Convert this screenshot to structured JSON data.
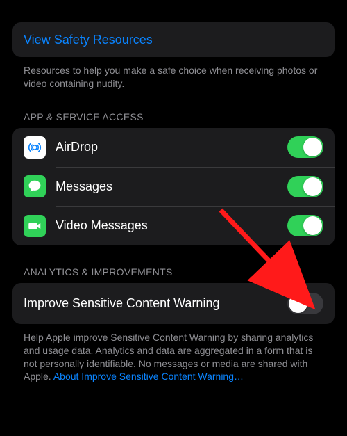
{
  "safety": {
    "link_label": "View Safety Resources",
    "footer": "Resources to help you make a safe choice when receiving photos or video containing nudity."
  },
  "app_access": {
    "header": "APP & SERVICE ACCESS",
    "items": [
      {
        "label": "AirDrop",
        "icon": "airdrop",
        "on": true
      },
      {
        "label": "Messages",
        "icon": "messages",
        "on": true
      },
      {
        "label": "Video Messages",
        "icon": "video",
        "on": true
      }
    ]
  },
  "analytics": {
    "header": "ANALYTICS & IMPROVEMENTS",
    "row_label": "Improve Sensitive Content Warning",
    "toggle_on": false,
    "footer_pre": "Help Apple improve Sensitive Content Warning by sharing analytics and usage data. Analytics and data are aggregated in a form that is not personally identifiable. No messages or media are shared with Apple. ",
    "footer_link": "About Improve Sensitive Content Warning…"
  }
}
